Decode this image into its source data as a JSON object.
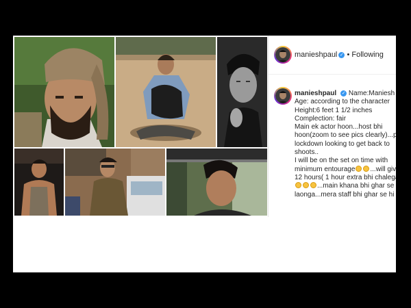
{
  "post": {
    "username": "manieshpaul",
    "verified_icon": "verified-badge-icon",
    "separator": "•",
    "follow_status": "Following",
    "caption_lines": [
      "Name:Maniesh Paul",
      "Age: according to the character",
      "Height:6 feet 1 1/2 inches",
      "Complection: fair",
      "Main ek actor hoon...host bhi",
      "hoon(zoom to see pics clearly)...post",
      "lockdown looking to get back to",
      "shoots..",
      "I will be on the set on time with",
      "minimum entourage",
      "12 hours( 1 hour extra bhi chalega",
      "...main khana bhi ghar se",
      "laonga...mera staff bhi ghar se hi"
    ],
    "caption_inline_suffix": "...will give"
  },
  "collage": {
    "photos": [
      {
        "name": "turban-portrait-photo"
      },
      {
        "name": "desert-sitting-photo"
      },
      {
        "name": "bw-portrait-photo"
      },
      {
        "name": "gym-photo"
      },
      {
        "name": "police-uniform-photo"
      },
      {
        "name": "car-window-photo"
      }
    ]
  },
  "colors": {
    "background": "#000000",
    "card": "#ffffff",
    "verified": "#3897f0",
    "text": "#262626"
  }
}
